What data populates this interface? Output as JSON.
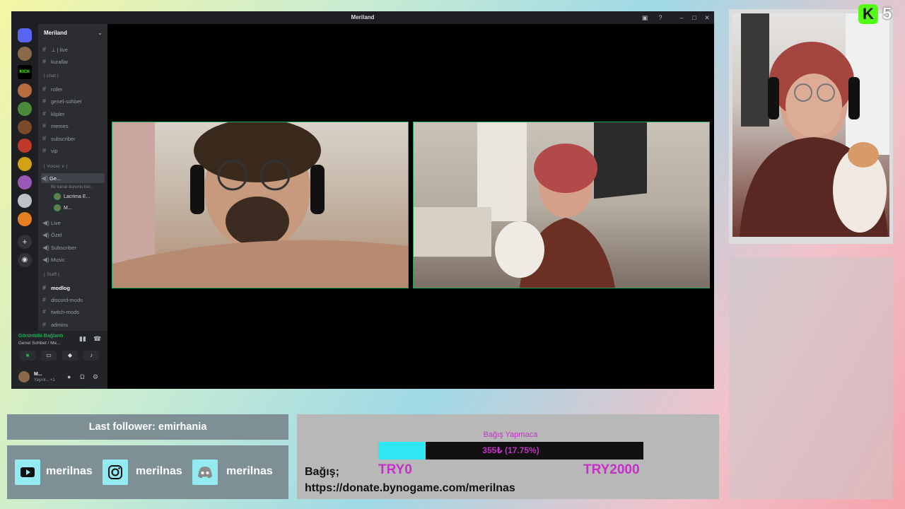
{
  "window": {
    "title": "Meriland",
    "server_name": "Meriland"
  },
  "channels": [
    {
      "name": "⊥ | live",
      "icon": "hash-icon"
    },
    {
      "name": "kurallar",
      "icon": "hash-icon"
    },
    {
      "name": "roller",
      "icon": "hash-icon"
    },
    {
      "name": "genel-sohbet",
      "icon": "hash-icon"
    },
    {
      "name": "klipler",
      "icon": "hash-icon"
    },
    {
      "name": "memes",
      "icon": "hash-icon"
    },
    {
      "name": "subscriber",
      "icon": "hash-icon"
    },
    {
      "name": "vip",
      "icon": "hash-icon"
    }
  ],
  "categories": {
    "chat": "| chat |",
    "voice": "| Voice| ∨ |",
    "staff": "| Staff |"
  },
  "voice_channels": [
    {
      "name": "Ge...",
      "icon": "speaker-icon"
    },
    {
      "name": "Live",
      "icon": "speaker-icon"
    },
    {
      "name": "Özel",
      "icon": "speaker-icon"
    },
    {
      "name": "Subscriber",
      "icon": "speaker-icon"
    },
    {
      "name": "Music",
      "icon": "speaker-icon"
    }
  ],
  "voice_status_hint": "Bir kanal durumu bel...",
  "voice_users": [
    "Lacrima E...",
    "M..."
  ],
  "staff_channels": [
    {
      "name": "modlog",
      "icon": "hash-icon",
      "active": true
    },
    {
      "name": "discord-mods",
      "icon": "hash-icon"
    },
    {
      "name": "twitch-mods",
      "icon": "hash-icon"
    },
    {
      "name": "admins",
      "icon": "hash-icon"
    }
  ],
  "voice_panel": {
    "status": "Görüntülü Bağlantı",
    "channel": "Genel Sohbet / Me..."
  },
  "user_panel": {
    "name": "M...",
    "status": "Yayınl... +1"
  },
  "kick_badge": {
    "letter": "K",
    "count": "5"
  },
  "last_follower": "Last follower: emirhania",
  "socials": [
    {
      "icon": "youtube-icon",
      "handle": "merilnas"
    },
    {
      "icon": "instagram-icon",
      "handle": "merilnas"
    },
    {
      "icon": "discord-icon",
      "handle": "merilnas"
    }
  ],
  "donation": {
    "title": "Bağış Yapmaca",
    "progress_text": "355₺ (17.75%)",
    "progress": 0.1775,
    "min_label": "TRY0",
    "max_label": "TRY2000",
    "label": "Bağış;",
    "url": "https://donate.bynogame.com/merilnas"
  },
  "colors": {
    "discord_bg": "#2b2d31",
    "accent_green": "#23a55a",
    "kick_green": "#53fc18",
    "donation_magenta": "#c531c8",
    "bar_cyan": "#2ee7f2"
  }
}
